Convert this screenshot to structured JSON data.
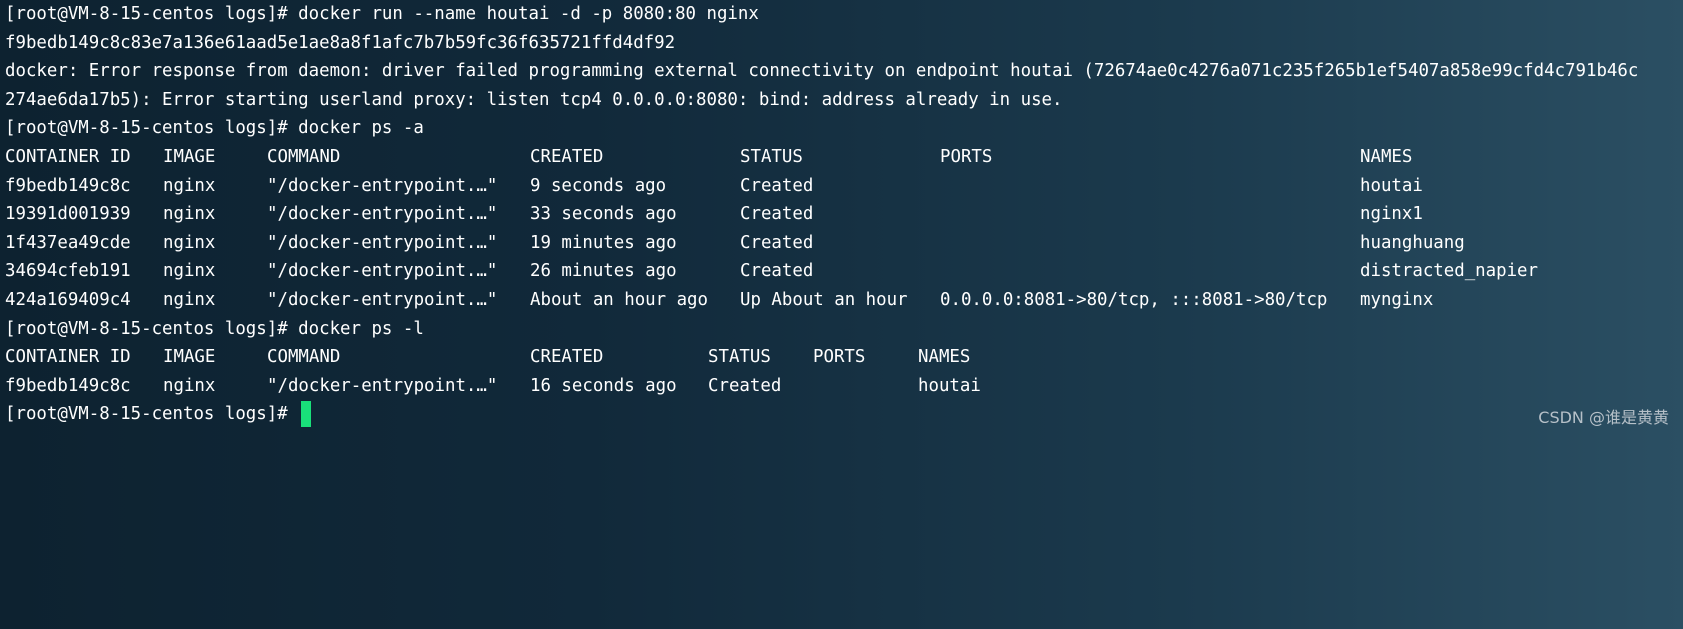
{
  "terminal": {
    "prompt_run": "[root@VM-8-15-centos logs]# docker run --name houtai -d -p 8080:80 nginx",
    "container_hash": "f9bedb149c8c83e7a136e61aad5e1ae8a8f1afc7b7b59fc36f635721ffd4df92",
    "error_line1": "docker: Error response from daemon: driver failed programming external connectivity on endpoint houtai (72674ae0c4276a071c235f265b1ef5407a858e99cfd4c791b46c",
    "error_line2": "274ae6da17b5): Error starting userland proxy: listen tcp4 0.0.0.0:8080: bind: address already in use.",
    "prompt_ps_a": "[root@VM-8-15-centos logs]# docker ps -a",
    "ps_a": {
      "headers": [
        "CONTAINER ID",
        "IMAGE",
        "COMMAND",
        "CREATED",
        "STATUS",
        "PORTS",
        "NAMES"
      ],
      "rows": [
        [
          "f9bedb149c8c",
          "nginx",
          "\"/docker-entrypoint.…\"",
          "9 seconds ago",
          "Created",
          "",
          "houtai"
        ],
        [
          "19391d001939",
          "nginx",
          "\"/docker-entrypoint.…\"",
          "33 seconds ago",
          "Created",
          "",
          "nginx1"
        ],
        [
          "1f437ea49cde",
          "nginx",
          "\"/docker-entrypoint.…\"",
          "19 minutes ago",
          "Created",
          "",
          "huanghuang"
        ],
        [
          "34694cfeb191",
          "nginx",
          "\"/docker-entrypoint.…\"",
          "26 minutes ago",
          "Created",
          "",
          "distracted_napier"
        ],
        [
          "424a169409c4",
          "nginx",
          "\"/docker-entrypoint.…\"",
          "About an hour ago",
          "Up About an hour",
          "0.0.0.0:8081->80/tcp, :::8081->80/tcp",
          "mynginx"
        ]
      ]
    },
    "prompt_ps_l": "[root@VM-8-15-centos logs]# docker ps -l",
    "ps_l": {
      "headers": [
        "CONTAINER ID",
        "IMAGE",
        "COMMAND",
        "CREATED",
        "STATUS",
        "PORTS",
        "NAMES"
      ],
      "rows": [
        [
          "f9bedb149c8c",
          "nginx",
          "\"/docker-entrypoint.…\"",
          "16 seconds ago",
          "Created",
          "",
          "houtai"
        ]
      ]
    },
    "prompt_final": "[root@VM-8-15-centos logs]# "
  },
  "watermark": "CSDN @谁是黄黄",
  "colors": {
    "text": "#ffffff",
    "cursor": "#19e07a",
    "background_left": "#0d2230",
    "background_right": "#2b4f63"
  }
}
